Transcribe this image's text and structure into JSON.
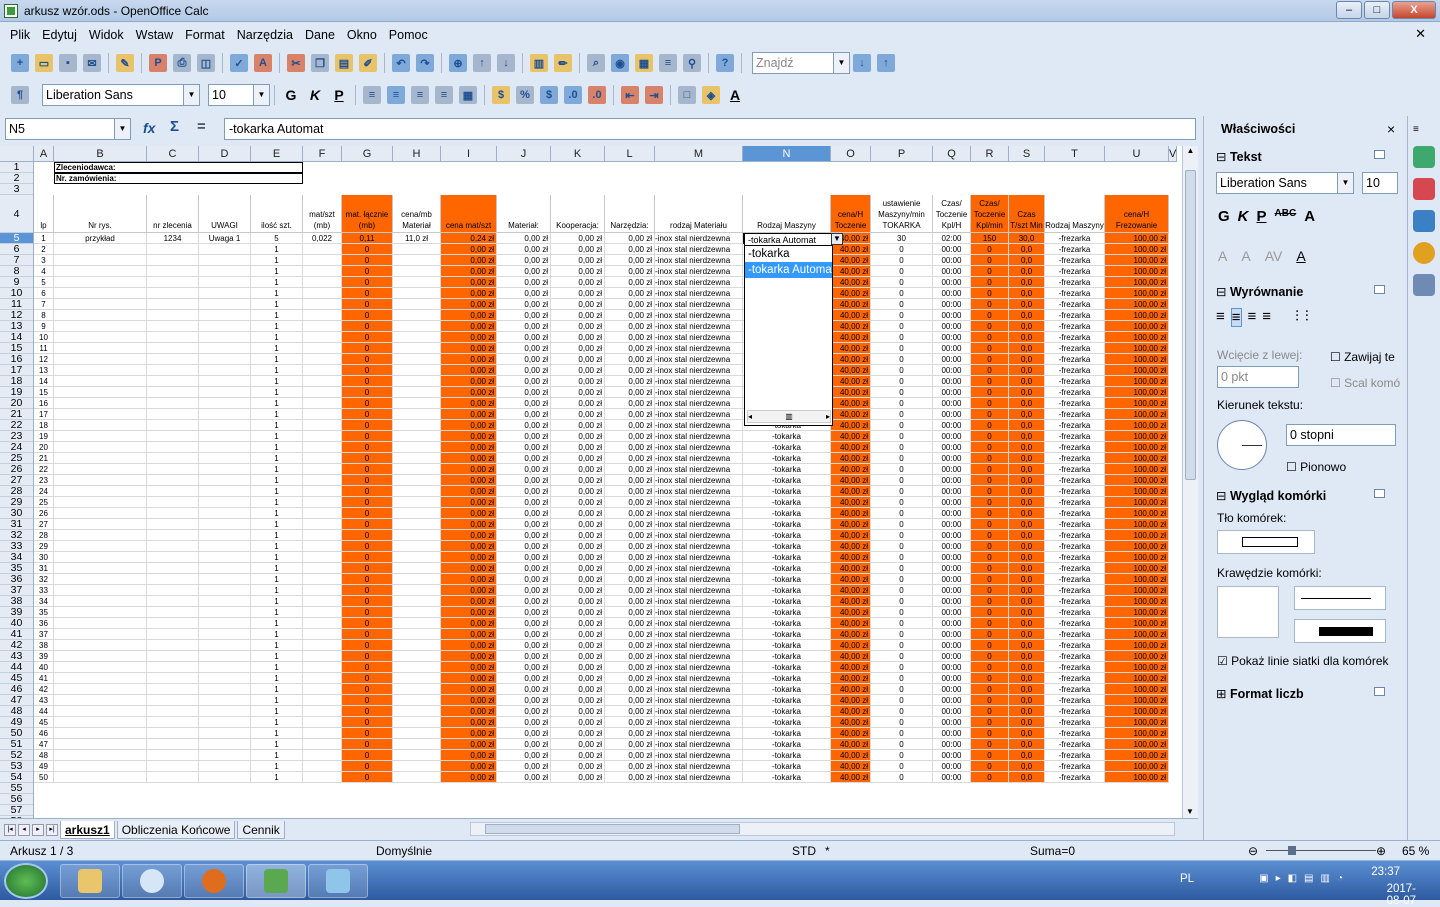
{
  "window": {
    "title": "arkusz wzór.ods - OpenOffice Calc",
    "minimize": "–",
    "maximize": "□",
    "close": "X"
  },
  "menu": [
    "Plik",
    "Edytuj",
    "Widok",
    "Wstaw",
    "Format",
    "Narzędzia",
    "Dane",
    "Okno",
    "Pomoc"
  ],
  "toolbar": {
    "find_placeholder": "Znajdź",
    "font_name": "Liberation Sans",
    "font_size": "10"
  },
  "formula": {
    "namebox": "N5",
    "content": "-tokarka Automat"
  },
  "columns": [
    {
      "id": "",
      "w": 34
    },
    {
      "id": "A",
      "w": 20
    },
    {
      "id": "B",
      "w": 93
    },
    {
      "id": "C",
      "w": 52
    },
    {
      "id": "D",
      "w": 52
    },
    {
      "id": "E",
      "w": 52
    },
    {
      "id": "F",
      "w": 39
    },
    {
      "id": "G",
      "w": 51
    },
    {
      "id": "H",
      "w": 48
    },
    {
      "id": "I",
      "w": 56
    },
    {
      "id": "J",
      "w": 54
    },
    {
      "id": "K",
      "w": 54
    },
    {
      "id": "L",
      "w": 50
    },
    {
      "id": "M",
      "w": 88
    },
    {
      "id": "N",
      "w": 88
    },
    {
      "id": "O",
      "w": 40
    },
    {
      "id": "P",
      "w": 62
    },
    {
      "id": "Q",
      "w": 38
    },
    {
      "id": "R",
      "w": 38
    },
    {
      "id": "S",
      "w": 36
    },
    {
      "id": "T",
      "w": 60
    },
    {
      "id": "U",
      "w": 64
    },
    {
      "id": "V",
      "w": 8
    }
  ],
  "selected_column": "N",
  "selected_row": "5",
  "orange_columns": [
    "G",
    "I",
    "O",
    "R",
    "S",
    "U"
  ],
  "header_rows": {
    "zleceniodawca": "Zleceniodawca:",
    "nr_zamowienia": "Nr. zamówienia:"
  },
  "header4": [
    "lp",
    "Nr rys.",
    "nr zlecenia",
    "UWAGI",
    "ilość szt.",
    "mat/szt (mb)",
    "mat. łącznie (mb)",
    "cena/mb Materiał",
    "cena mat/szt",
    "Materiał:",
    "Kooperacja:",
    "Narzędzia:",
    "rodzaj Materiału",
    "Rodzaj Maszyny",
    "cena/H Toczenie",
    "ustawienie Maszyny/min TOKARKA",
    "Czas/ Toczenie Kpl/H",
    "Czas/ Toczenie Kpl/min",
    "Czas T/szt Min",
    "Rodzaj Maszyny",
    "cena/H Frezowanie"
  ],
  "row5": [
    "1",
    "przykład",
    "1234",
    "Uwaga 1",
    "5",
    "0,022",
    "0,11",
    "11,0 zł",
    "0,24 zł",
    "0,00 zł",
    "0,00 zł",
    "0,00 zł",
    "-inox stal nierdzewna",
    "-tokarka Automat",
    "40,00 zł",
    "30",
    "02:00",
    "150",
    "30,0",
    "-frezarka",
    "100,00 zł"
  ],
  "data_row_template": {
    "g": "0",
    "i": "0,00 zł",
    "j": "0,00 zł",
    "k": "0,00 zł",
    "l": "0,00 zł",
    "m": "-inox stal nierdzewna",
    "n": "-tokarka",
    "o": "40,00 zł",
    "p": "0",
    "q": "00:00",
    "r": "0",
    "s": "0,0",
    "t": "-frezarka",
    "u": "100,00 zł",
    "e": "1"
  },
  "dropdown": {
    "current": "-tokarka Automat",
    "options": [
      "-tokarka",
      "-tokarka Automat"
    ],
    "highlighted": "-tokarka Automat"
  },
  "sheets": {
    "tabs": [
      "arkusz1",
      "Obliczenia Końcowe",
      "Cennik"
    ],
    "active": "arkusz1"
  },
  "status": {
    "sheet": "Arkusz 1 / 3",
    "style": "Domyślnie",
    "mode": "STD",
    "modified": "*",
    "sum": "Suma=0",
    "zoom": "65 %"
  },
  "sidebar": {
    "title": "Właściwości",
    "text_section": "Tekst",
    "font_name": "Liberation Sans",
    "font_size": "10",
    "align_section": "Wyrównanie",
    "indent_label": "Wcięcie z lewej:",
    "indent_value": "0 pkt",
    "wrap_label": "Zawijaj te",
    "merge_label": "Scal komó",
    "direction_label": "Kierunek tekstu:",
    "degrees": "0 stopni",
    "vertical_label": "Pionowo",
    "cell_section": "Wygląd komórki",
    "bg_label": "Tło komórek:",
    "borders_label": "Krawędzie komórki:",
    "gridlines_label": "Pokaż linie siatki dla komórek",
    "numfmt_section": "Format liczb"
  },
  "taskbar": {
    "lang": "PL",
    "time": "23:37",
    "date": "2017-08-07"
  }
}
